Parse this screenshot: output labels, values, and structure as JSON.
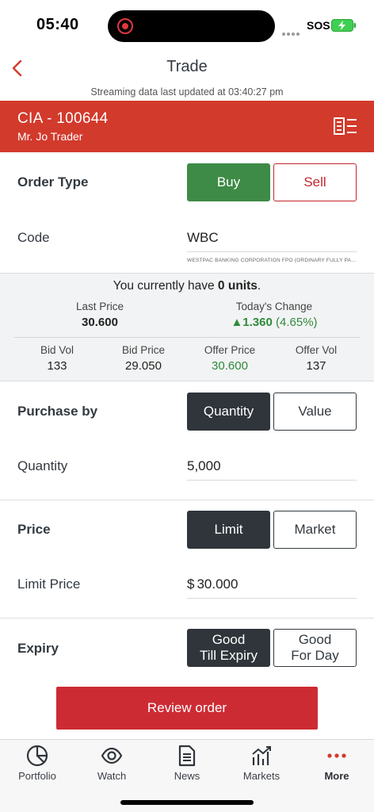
{
  "status_bar": {
    "time": "05:40",
    "carrier": "SOS"
  },
  "header": {
    "title": "Trade",
    "stream_text": "Streaming data last updated at 03:40:27 pm"
  },
  "account": {
    "id": "CIA - 100644",
    "name": "Mr. Jo Trader"
  },
  "order_type": {
    "label": "Order Type",
    "buy": "Buy",
    "sell": "Sell"
  },
  "code": {
    "label": "Code",
    "value": "WBC",
    "description": "WESTPAC BANKING CORPORATION FPO (ORDINARY FULLY PAID)"
  },
  "market": {
    "holding_prefix": "You currently have ",
    "holding_units": "0 units",
    "holding_suffix": ".",
    "last_price_label": "Last Price",
    "last_price": "30.600",
    "change_label": "Today's Change",
    "change_value": "▲1.360",
    "change_pct": "(4.65%)",
    "bid_vol_label": "Bid Vol",
    "bid_vol": "133",
    "bid_price_label": "Bid Price",
    "bid_price": "29.050",
    "offer_price_label": "Offer Price",
    "offer_price": "30.600",
    "offer_vol_label": "Offer Vol",
    "offer_vol": "137"
  },
  "purchase_by": {
    "label": "Purchase by",
    "quantity": "Quantity",
    "value": "Value"
  },
  "quantity": {
    "label": "Quantity",
    "value": "5,000"
  },
  "price": {
    "label": "Price",
    "limit": "Limit",
    "market": "Market"
  },
  "limit_price": {
    "label": "Limit Price",
    "currency": "$",
    "value": "30.000"
  },
  "expiry": {
    "label": "Expiry",
    "gtc_line1": "Good",
    "gtc_line2": "Till Expiry",
    "gfd_line1": "Good",
    "gfd_line2": "For Day"
  },
  "review_button": "Review order",
  "tabs": [
    {
      "label": "Portfolio",
      "icon": "pie-chart-icon"
    },
    {
      "label": "Watch",
      "icon": "eye-icon"
    },
    {
      "label": "News",
      "icon": "document-icon"
    },
    {
      "label": "Markets",
      "icon": "bar-chart-icon"
    },
    {
      "label": "More",
      "icon": "more-dots-icon"
    }
  ],
  "colors": {
    "brand_red": "#d23a2c",
    "buy_green": "#3d8b47",
    "dark_button": "#2f353b",
    "review_red": "#cd2b34",
    "positive_green": "#2f8a3c"
  }
}
